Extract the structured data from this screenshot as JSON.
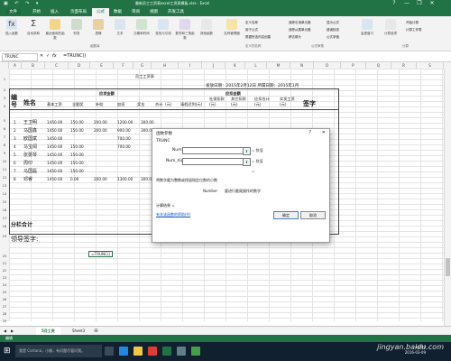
{
  "titlebar": {
    "title": "最新员工工资表excel工资表模板.xlsx - Excel",
    "buttons": [
      "?",
      "—",
      "❐",
      "✕"
    ]
  },
  "ribbon": {
    "tabs": [
      "文件",
      "开始",
      "插入",
      "页面布局",
      "公式",
      "数据",
      "审阅",
      "视图",
      "开发工具"
    ],
    "active_tab": "公式",
    "buttons": [
      {
        "label": "插入函数",
        "icon": "insert-function-icon"
      },
      {
        "label": "自动求和",
        "icon": "autosum-icon"
      },
      {
        "label": "最近使用的函数",
        "icon": "recent-icon"
      },
      {
        "label": "财务",
        "icon": "finance-icon"
      },
      {
        "label": "逻辑",
        "icon": "logic-icon"
      },
      {
        "label": "文本",
        "icon": "text-icon"
      },
      {
        "label": "日期和时间",
        "icon": "date-icon"
      },
      {
        "label": "查找与引用",
        "icon": "lookup-icon"
      },
      {
        "label": "数学和三角函数",
        "icon": "math-icon"
      },
      {
        "label": "其他函数",
        "icon": "more-functions-icon"
      },
      {
        "label": "名称管理器",
        "icon": "name-manager-icon"
      },
      {
        "label": "定义名称",
        "icon": "define-name-icon"
      },
      {
        "label": "用于公式",
        "icon": "use-in-formula-icon"
      },
      {
        "label": "根据所选内容创建",
        "icon": "create-from-selection-icon"
      },
      {
        "label": "追踪引用单元格",
        "icon": "trace-precedents-icon"
      },
      {
        "label": "追踪从属单元格",
        "icon": "trace-dependents-icon"
      },
      {
        "label": "移去箭头",
        "icon": "remove-arrows-icon"
      },
      {
        "label": "显示公式",
        "icon": "show-formulas-icon"
      },
      {
        "label": "错误检查",
        "icon": "error-check-icon"
      },
      {
        "label": "公式求值",
        "icon": "evaluate-icon"
      },
      {
        "label": "监视窗口",
        "icon": "watch-window-icon"
      },
      {
        "label": "计算选项",
        "icon": "calc-options-icon"
      },
      {
        "label": "开始计算",
        "icon": "calc-now-icon"
      },
      {
        "label": "计算工作表",
        "icon": "calc-sheet-icon"
      }
    ],
    "groups": [
      "函数库",
      "定义的名称",
      "公式审核",
      "计算"
    ]
  },
  "formula_bar": {
    "name_box": "TRUNC",
    "fx": "fx",
    "formula": "=TRUNC()"
  },
  "columns": [
    "A",
    "B",
    "C",
    "D",
    "E",
    "F",
    "G",
    "H",
    "I",
    "J",
    "K",
    "L",
    "M",
    "N",
    "O",
    "P",
    "Q",
    "R",
    "S"
  ],
  "rows": [
    "1",
    "2",
    "3",
    "4",
    "5",
    "6",
    "7",
    "8",
    "9",
    "10",
    "11",
    "12",
    "13",
    "14",
    "15",
    "16",
    "17",
    "18",
    "19",
    "20",
    "21",
    "22",
    "23",
    "24",
    "25",
    "26",
    "27",
    "28",
    "29"
  ],
  "sheet": {
    "title": "员工工资表",
    "issue_date": "发放日期：2015年2月12日 所属日期：2015年1月",
    "headers": {
      "no": "编号",
      "name": "姓名",
      "payable": "应发金额",
      "basic": "基本工资",
      "allowance": "全勤奖",
      "subsidy": "补助",
      "overtime": "加班",
      "bonus": "奖金",
      "total": "合计（元）",
      "deduct": "应扣金额",
      "late": "请假迟到(元)",
      "insurance": "社保扣款(元)",
      "other": "其它扣款(元)",
      "deduct_total": "应扣合计(元)",
      "actual": "实发工资(元)",
      "sign": "签字"
    },
    "employees": [
      {
        "no": "1",
        "name": "王卫明",
        "basic": "1450.00",
        "allowance": "150.00",
        "subsidy": "200.00",
        "overtime": "1200.00",
        "bonus": "300.00"
      },
      {
        "no": "2",
        "name": "马国鑫",
        "basic": "1450.00",
        "allowance": "150.00",
        "subsidy": "200.00",
        "overtime": "900.00",
        "bonus": "300.00"
      },
      {
        "no": "3",
        "name": "欧国斌",
        "basic": "1450.00",
        "allowance": "",
        "subsidy": "",
        "overtime": "700.00",
        "bonus": ""
      },
      {
        "no": "4",
        "name": "马宝阅",
        "basic": "1450.00",
        "allowance": "150.00",
        "subsidy": "",
        "overtime": "700.00",
        "bonus": ""
      },
      {
        "no": "5",
        "name": "张晏琴",
        "basic": "1450.00",
        "allowance": "150.00",
        "subsidy": "",
        "overtime": "",
        "bonus": ""
      },
      {
        "no": "6",
        "name": "周印",
        "basic": "1450.00",
        "allowance": "150.00",
        "subsidy": "",
        "overtime": "",
        "bonus": ""
      },
      {
        "no": "7",
        "name": "马国磊",
        "basic": "1450.00",
        "allowance": "150.00",
        "subsidy": "",
        "overtime": "",
        "bonus": ""
      },
      {
        "no": "8",
        "name": "邓睿",
        "basic": "1450.00",
        "allowance": "0.00",
        "subsidy": "200.00",
        "overtime": "1300.00",
        "bonus": "300.00"
      }
    ],
    "subtotal_label": "分栏合计",
    "leader_sign": "领导签字:",
    "active_cell_formula": "=TRUNC()"
  },
  "dialog": {
    "title": "函数参数",
    "function_name": "TRUNC",
    "args": [
      {
        "label": "Number",
        "value": "= 数值"
      },
      {
        "label": "Num_digits",
        "value": "= 数值"
      }
    ],
    "result_eq": "=",
    "description": "将数字截为整数或保留指定位数的小数",
    "param_name": "Number",
    "param_desc": "要进行截尾操作的数字",
    "calc_result": "计算结果 =",
    "help_link": "有关该函数的帮助(H)",
    "ok": "确定",
    "cancel": "取消",
    "help_icon": "?",
    "close_icon": "✕"
  },
  "sheet_tabs": [
    "5月工资",
    "Sheet3"
  ],
  "active_sheet": "5月工资",
  "status": {
    "mode": "编辑"
  },
  "taskbar": {
    "search_placeholder": "我是 Cortana，小娜，有问题尽管问我。",
    "time": "14:50",
    "date": "2016-03-09"
  },
  "watermark": "jingyan.baidu.com",
  "colors": {
    "excel_green": "#217346",
    "taskbar": "#10202f"
  }
}
